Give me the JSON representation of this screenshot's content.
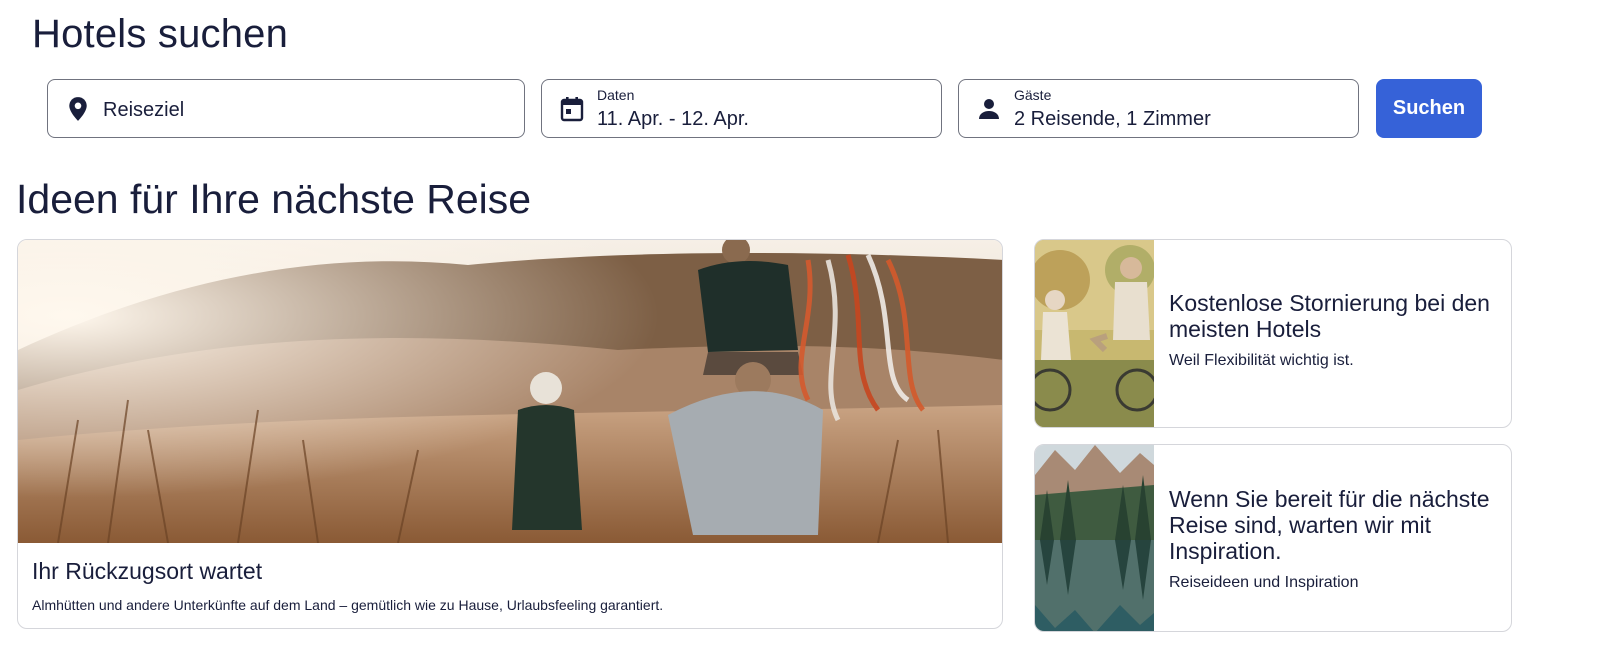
{
  "search": {
    "heading": "Hotels suchen",
    "destination": {
      "placeholder": "Reiseziel",
      "icon": "location-pin-icon"
    },
    "dates": {
      "label": "Daten",
      "value": "11. Apr. - 12. Apr.",
      "icon": "calendar-icon"
    },
    "guests": {
      "label": "Gäste",
      "value": "2 Reisende, 1 Zimmer",
      "icon": "person-icon"
    },
    "button_label": "Suchen"
  },
  "ideas": {
    "heading": "Ideen für Ihre nächste Reise",
    "main_card": {
      "title": "Ihr Rückzugsort wartet",
      "description": "Almhütten und andere Unterkünfte auf dem Land – gemütlich wie zu Hause, Urlaubsfeeling garantiert."
    },
    "side_cards": [
      {
        "title": "Kostenlose Stornierung bei den meisten Hotels",
        "subtitle": "Weil Flexibilität wichtig ist."
      },
      {
        "title": "Wenn Sie bereit für die nächste Reise sind, warten wir mit Inspiration.",
        "subtitle": "Reiseideen und Inspiration"
      }
    ]
  },
  "colors": {
    "primary": "#3662d8",
    "text": "#191e3b",
    "border": "#70737f"
  }
}
